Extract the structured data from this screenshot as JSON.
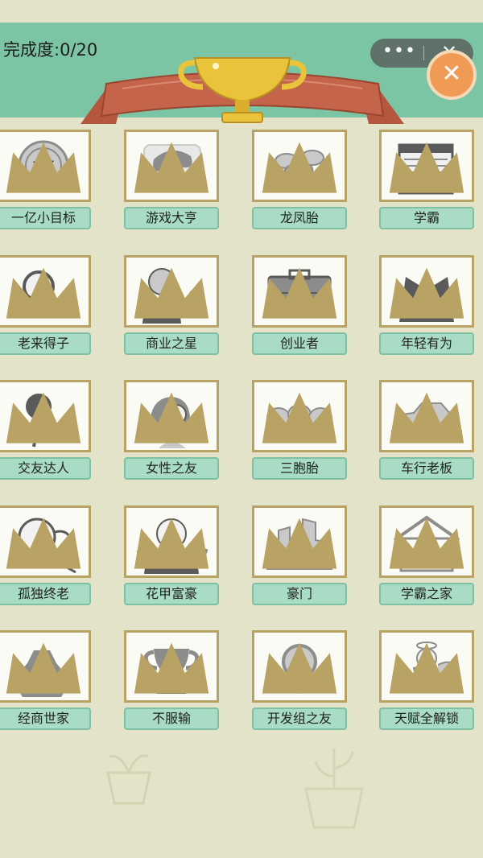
{
  "header": {
    "progress_label": "完成度:0/20",
    "more_glyph": "•••",
    "close_glyph": "✕",
    "exit_glyph": "✕"
  },
  "colors": {
    "background": "#e3e3c9",
    "header": "#7cc5a4",
    "ribbon": "#c4644a",
    "trophy": "#e9c33a",
    "label_fill": "#a8dcc4",
    "card_border": "#b9a364",
    "exit_button": "#ef9a55"
  },
  "achievements": [
    {
      "label": "一亿小目标",
      "icon": "coin-icon",
      "locked": true
    },
    {
      "label": "游戏大亨",
      "icon": "gamepad-icon",
      "locked": true
    },
    {
      "label": "龙凤胎",
      "icon": "pacifiers-icon",
      "locked": true
    },
    {
      "label": "学霸",
      "icon": "books-icon",
      "locked": true
    },
    {
      "label": "老来得子",
      "icon": "magnifier-icon",
      "locked": true
    },
    {
      "label": "商业之星",
      "icon": "speaker-icon",
      "locked": true
    },
    {
      "label": "创业者",
      "icon": "briefcase-icon",
      "locked": true
    },
    {
      "label": "年轻有为",
      "icon": "suit-icon",
      "locked": true
    },
    {
      "label": "交友达人",
      "icon": "rose-icon",
      "locked": true
    },
    {
      "label": "女性之友",
      "icon": "woman-icon",
      "locked": true
    },
    {
      "label": "三胞胎",
      "icon": "triplets-icon",
      "locked": true
    },
    {
      "label": "车行老板",
      "icon": "car-icon",
      "locked": true
    },
    {
      "label": "孤独终老",
      "icon": "old-man-icon",
      "locked": true
    },
    {
      "label": "花甲富豪",
      "icon": "rich-man-icon",
      "locked": true
    },
    {
      "label": "豪门",
      "icon": "mansion-icon",
      "locked": true
    },
    {
      "label": "学霸之家",
      "icon": "grad-house-icon",
      "locked": true
    },
    {
      "label": "经商世家",
      "icon": "money-bag-icon",
      "locked": true
    },
    {
      "label": "不服输",
      "icon": "trophy-icon",
      "locked": true
    },
    {
      "label": "开发组之友",
      "icon": "medal-icon",
      "locked": true
    },
    {
      "label": "天赋全解锁",
      "icon": "cupid-icon",
      "locked": true
    }
  ]
}
